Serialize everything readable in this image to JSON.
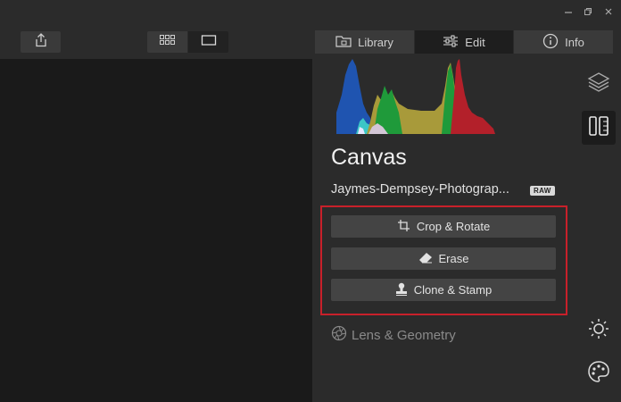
{
  "window": {
    "controls": [
      "minimize-icon",
      "restore-icon",
      "close-icon"
    ]
  },
  "toolbar": {
    "share_icon": "share-icon",
    "view_grid_icon": "grid-view-icon",
    "view_single_icon": "single-view-icon",
    "tabs": [
      {
        "label": "Library",
        "icon": "library-icon",
        "active": false
      },
      {
        "label": "Edit",
        "icon": "sliders-icon",
        "active": true
      },
      {
        "label": "Info",
        "icon": "info-icon",
        "active": false
      }
    ]
  },
  "panel": {
    "title": "Canvas",
    "filename": "Jaymes-Dempsey-Photograp...",
    "badge": "RAW",
    "tools": [
      {
        "label": "Crop & Rotate",
        "icon": "crop-icon"
      },
      {
        "label": "Erase",
        "icon": "eraser-icon"
      },
      {
        "label": "Clone & Stamp",
        "icon": "stamp-icon"
      }
    ],
    "next_section": {
      "label": "Lens & Geometry",
      "icon": "aperture-icon"
    }
  },
  "rail": {
    "items": [
      "layers-icon",
      "canvas-tools-icon",
      "light-icon",
      "color-palette-icon"
    ],
    "active": "canvas-tools-icon"
  },
  "colors": {
    "accent_highlight": "#c8202a",
    "histogram_blue": "#1f54b0",
    "histogram_green": "#1f9a3a",
    "histogram_red": "#b3202a",
    "histogram_yellow": "#a89a3a"
  }
}
